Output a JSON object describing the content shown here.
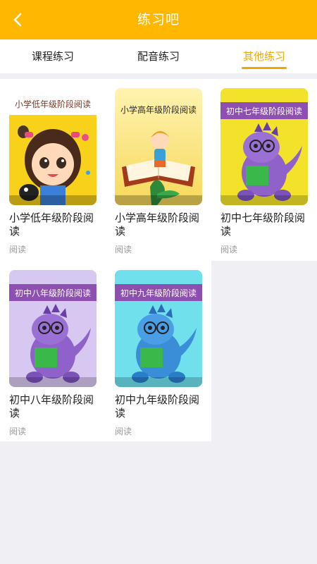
{
  "header": {
    "title": "练习吧"
  },
  "tabs": [
    {
      "label": "课程练习"
    },
    {
      "label": "配音练习"
    },
    {
      "label": "其他练习"
    }
  ],
  "active_tab": 2,
  "colors": {
    "accent": "#ffb700",
    "active_tab": "#f0a800"
  },
  "cards": [
    {
      "cover_label": "小学低年级阶段阅读",
      "title": "小学低年级阶段阅读",
      "category": "阅读"
    },
    {
      "cover_label": "小学高年级阶段阅读",
      "title": "小学高年级阶段阅读",
      "category": "阅读"
    },
    {
      "cover_label": "初中七年级阶段阅读",
      "title": "初中七年级阶段阅读",
      "category": "阅读"
    },
    {
      "cover_label": "初中八年级阶段阅读",
      "title": "初中八年级阶段阅读",
      "category": "阅读"
    },
    {
      "cover_label": "初中九年级阶段阅读",
      "title": "初中九年级阶段阅读",
      "category": "阅读"
    }
  ]
}
